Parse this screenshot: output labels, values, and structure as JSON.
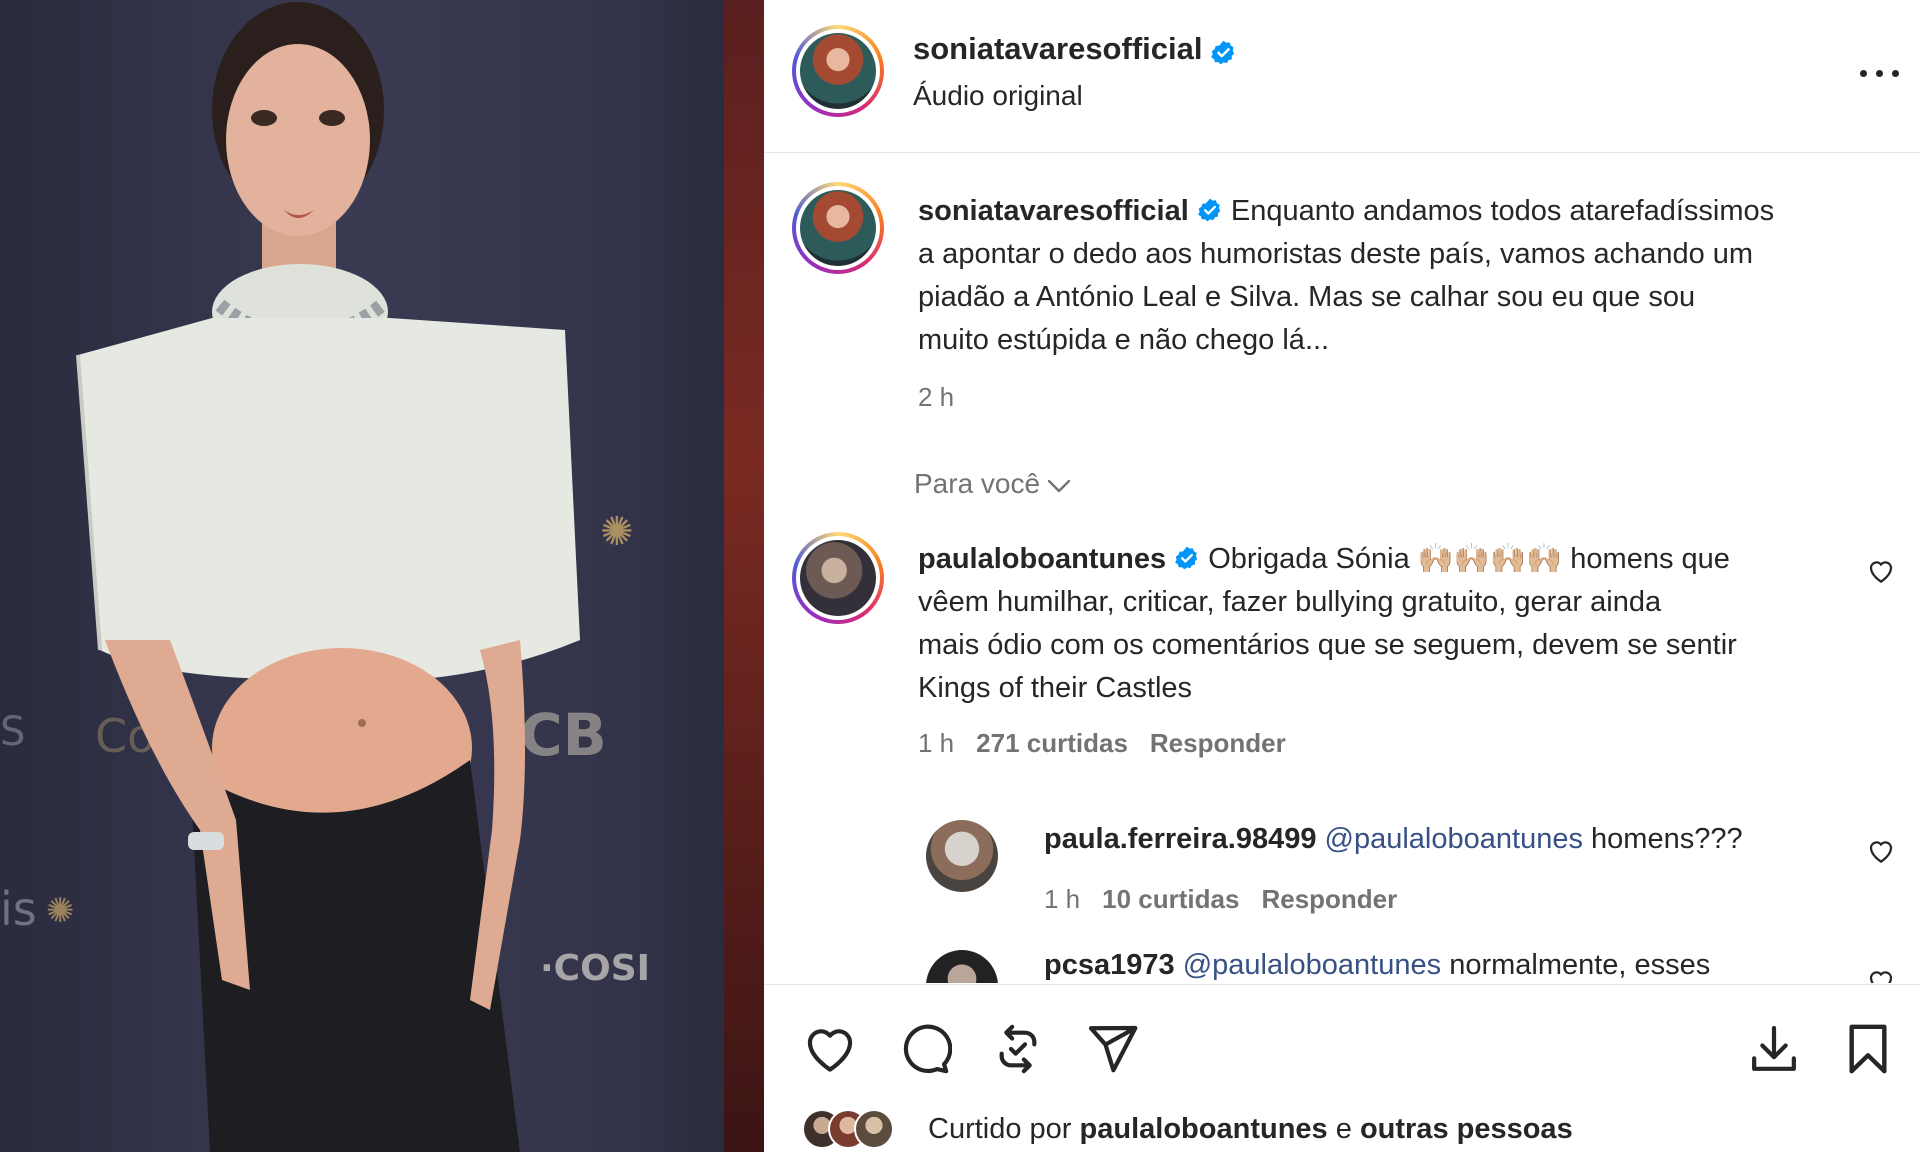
{
  "post": {
    "author": "soniatavaresofficial",
    "audio": "Áudio original"
  },
  "caption": {
    "author": "soniatavaresofficial",
    "text_line1": "Enquanto andamos todos atarefadíssimos",
    "text_line2": "a apontar o dedo aos humoristas deste país, vamos achando um",
    "text_line3": "piadão a António Leal e Silva. Mas se calhar sou eu que sou",
    "text_line4": "muito estúpida e não chego lá...",
    "time": "2 h"
  },
  "for_you_label": "Para você",
  "comments": [
    {
      "author": "paulaloboantunes",
      "line1": "Obrigada Sónia 🙌🏼🙌🏼🙌🏼🙌🏼 homens que",
      "line2": "vêem humilhar, criticar, fazer bullying gratuito, gerar ainda",
      "line3": "mais ódio com os comentários que se seguem, devem se sentir",
      "line4": "Kings of their Castles",
      "time": "1 h",
      "likes": "271 curtidas",
      "reply": "Responder"
    },
    {
      "author": "paula.ferreira.98499",
      "mention": "@paulaloboantunes",
      "text": "homens???",
      "time": "1 h",
      "likes": "10 curtidas",
      "reply": "Responder"
    },
    {
      "author": "pcsa1973",
      "mention": "@paulaloboantunes",
      "text": "normalmente, esses"
    }
  ],
  "liked_by": {
    "prefix": "Curtido por",
    "user": "paulaloboantunes",
    "conj": "e",
    "others": "outras pessoas"
  },
  "icons": {
    "verified": "verified-badge-icon",
    "more": "more-options-icon",
    "like": "heart-icon",
    "comment": "comment-icon",
    "repost": "repost-icon",
    "share": "send-icon",
    "download": "download-icon",
    "save": "bookmark-icon"
  },
  "colors": {
    "verified_blue": "#0095f6",
    "muted": "#737373",
    "text": "#262626",
    "mention": "#385185"
  }
}
